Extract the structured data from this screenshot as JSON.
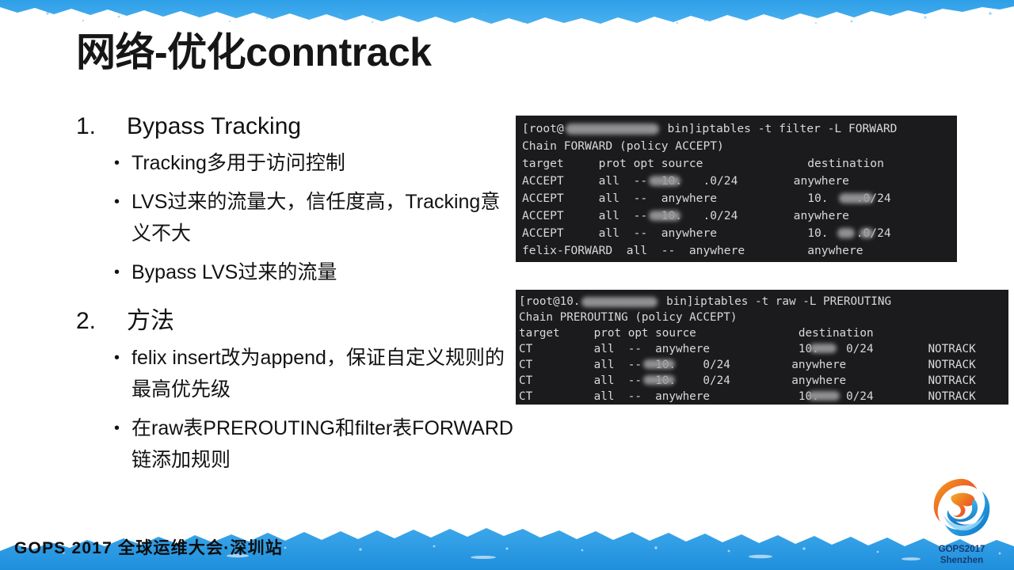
{
  "slide": {
    "title": "网络-优化conntrack"
  },
  "content": {
    "items": [
      {
        "number": "1.",
        "heading": "Bypass Tracking",
        "subs": [
          "Tracking多用于访问控制",
          "LVS过来的流量大，信任度高，Tracking意义不大",
          "Bypass LVS过来的流量"
        ]
      },
      {
        "number": "2.",
        "heading": "方法",
        "subs": [
          "felix insert改为append，保证自定义规则的最高优先级",
          "在raw表PREROUTING和filter表FORWARD链添加规则"
        ]
      }
    ]
  },
  "terminals": [
    {
      "name": "iptables-filter-forward",
      "prompt_prefix": "[root@",
      "prompt_suffix": " bin]iptables -t filter -L FORWARD",
      "chain_line": "Chain FORWARD (policy ACCEPT)",
      "header": "target     prot opt source               destination",
      "rows": [
        "ACCEPT     all  --  10.   .0/24        anywhere",
        "ACCEPT     all  --  anywhere             10.    .0/24",
        "ACCEPT     all  --  10.   .0/24        anywhere",
        "ACCEPT     all  --  anywhere             10.    .0/24",
        "felix-FORWARD  all  --  anywhere         anywhere"
      ]
    },
    {
      "name": "iptables-raw-prerouting",
      "prompt_prefix": "[root@10.",
      "prompt_suffix": " bin]iptables -t raw -L PREROUTING",
      "chain_line": "Chain PREROUTING (policy ACCEPT)",
      "header": "target     prot opt source               destination",
      "rows": [
        "CT         all  --  anywhere             10.    0/24        NOTRACK",
        "CT         all  --  10.    0/24         anywhere            NOTRACK",
        "CT         all  --  10.    0/24         anywhere            NOTRACK",
        "CT         all  --  anywhere             10.    0/24        NOTRACK"
      ]
    }
  ],
  "footer": {
    "text": "GOPS 2017 全球运维大会·深圳站"
  },
  "logo": {
    "line1": "GOPS2017",
    "line2": "Shenzhen"
  },
  "colors": {
    "banner_blue": "#2b9ae4",
    "terminal_bg": "#1b1b1d",
    "terminal_fg": "#d9d9d9",
    "logo_blue": "#173a6e"
  }
}
